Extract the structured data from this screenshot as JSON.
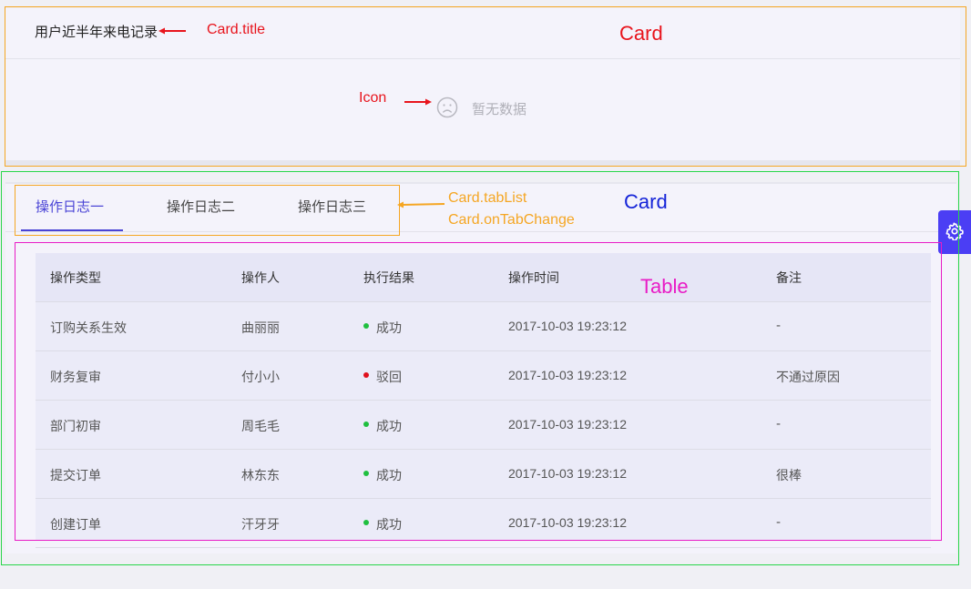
{
  "card1": {
    "title": "用户近半年来电记录",
    "empty_text": "暂无数据"
  },
  "card2": {
    "tabs": [
      {
        "label": "操作日志一",
        "active": true
      },
      {
        "label": "操作日志二",
        "active": false
      },
      {
        "label": "操作日志三",
        "active": false
      }
    ],
    "table": {
      "columns": [
        "操作类型",
        "操作人",
        "执行结果",
        "操作时间",
        "备注"
      ],
      "rows": [
        {
          "type": "订购关系生效",
          "operator": "曲丽丽",
          "result": "成功",
          "status": "success",
          "time": "2017-10-03 19:23:12",
          "note": "-"
        },
        {
          "type": "财务复审",
          "operator": "付小小",
          "result": "驳回",
          "status": "error",
          "time": "2017-10-03 19:23:12",
          "note": "不通过原因"
        },
        {
          "type": "部门初审",
          "operator": "周毛毛",
          "result": "成功",
          "status": "success",
          "time": "2017-10-03 19:23:12",
          "note": "-"
        },
        {
          "type": "提交订单",
          "operator": "林东东",
          "result": "成功",
          "status": "success",
          "time": "2017-10-03 19:23:12",
          "note": "很棒"
        },
        {
          "type": "创建订单",
          "operator": "汗牙牙",
          "result": "成功",
          "status": "success",
          "time": "2017-10-03 19:23:12",
          "note": "-"
        }
      ]
    }
  },
  "annotations": {
    "card_title": "Card.title",
    "card1_label": "Card",
    "icon_label": "Icon",
    "tablist": "Card.tabList",
    "ontabchange": "Card.onTabChange",
    "card2_label": "Card",
    "table_label": "Table"
  },
  "colors": {
    "primary": "#4a44d6",
    "success": "#1fbf3f",
    "error": "#e0101d",
    "annotation_red": "#e8141c",
    "annotation_orange": "#f5a623",
    "annotation_green": "#29d64a",
    "annotation_blue": "#1423d8",
    "annotation_magenta": "#e81cc6",
    "settings_button": "#4b3ef4"
  },
  "icons": {
    "empty": "frown-icon",
    "settings": "gear-icon"
  }
}
